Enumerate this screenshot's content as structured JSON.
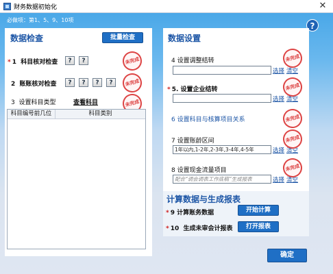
{
  "window": {
    "title": "财务数据初始化",
    "close": "✕"
  },
  "required_items": "必做项：第1、5、9、10项",
  "help": "?",
  "left": {
    "title": "数据检查",
    "batch_button": "批量检查",
    "rows": [
      {
        "num": "1",
        "label": "科目核对检查",
        "star": "*"
      },
      {
        "num": "2",
        "label": "账账核对检查"
      }
    ],
    "row3": {
      "num": "3",
      "label": "设置科目类型",
      "link": "查看科目"
    },
    "table": {
      "headers": [
        "科目编号前几位",
        "科目类别"
      ]
    }
  },
  "right": {
    "title": "数据设置",
    "items": [
      {
        "num": "4",
        "label": "设置调整结转",
        "value": ""
      },
      {
        "num": "5.",
        "label": "设置企业结转",
        "star": "*",
        "value": ""
      },
      {
        "num": "6",
        "label": "设置科目与核算项目关系"
      },
      {
        "num": "7",
        "label": "设置账龄区间",
        "value": "1年以内,1-2年,2-3年,3-4年,4-5年"
      },
      {
        "num": "8",
        "label": "设置现金流量项目",
        "value": "配合\"调会",
        "placeholder": "配合“调会调表工作底稿”生成报表"
      }
    ],
    "select_label": "选择",
    "clear_label": "清空"
  },
  "calc": {
    "title": "计算数据与生成报表",
    "rows": [
      {
        "num": "9",
        "label": "计算账务数据",
        "button": "开始计算",
        "star": "*"
      },
      {
        "num": "10",
        "label": "生成未审会计报表",
        "button": "打开报表",
        "star": "*"
      }
    ]
  },
  "ok_button": "确定",
  "stamp_text": "未完成",
  "qmark": "?"
}
